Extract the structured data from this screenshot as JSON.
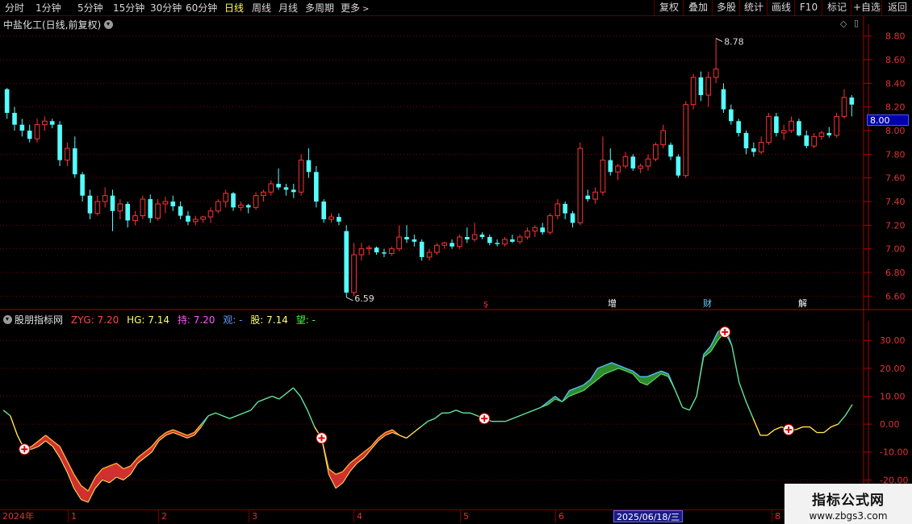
{
  "toolbar": {
    "left_items": [
      "分时",
      "1分钟",
      "5分钟",
      "15分钟",
      "30分钟",
      "60分钟",
      "日线",
      "周线",
      "月线",
      "多周期",
      "更多"
    ],
    "active": "日线",
    "right_items": [
      "复权",
      "叠加",
      "多股",
      "统计",
      "画线",
      "F10",
      "标记",
      "+自选",
      "返回"
    ]
  },
  "main_panel": {
    "title": "中盐化工(日线,前复权)",
    "max_label": "8.78",
    "min_label": "6.59",
    "current_price": "8.00",
    "y_ticks": [
      "8.80",
      "8.60",
      "8.40",
      "8.20",
      "8.00",
      "7.80",
      "7.60",
      "7.40",
      "7.20",
      "7.00",
      "6.80",
      "6.60"
    ],
    "events": [
      {
        "label": "ş",
        "color": "#ff3333"
      },
      {
        "label": "增",
        "color": "#ffffff"
      },
      {
        "label": "财",
        "color": "#66ccff"
      },
      {
        "label": "解",
        "color": "#ffffff"
      }
    ]
  },
  "indicator_panel": {
    "name": "股朋指标网",
    "values": [
      {
        "label": "ZYG: 7.20",
        "color": "#ff4444"
      },
      {
        "label": "HG: 7.14",
        "color": "#ffff66"
      },
      {
        "label": "持: 7.20",
        "color": "#ff55ff"
      },
      {
        "label": "观: -",
        "color": "#6699ff"
      },
      {
        "label": "股: 7.14",
        "color": "#ffff66"
      },
      {
        "label": "望: -",
        "color": "#44ff44"
      }
    ],
    "y_ticks": [
      "30.00",
      "20.00",
      "10.00",
      "0.00",
      "-10.00",
      "-20.00"
    ]
  },
  "date_axis": {
    "labels": [
      "2024年",
      "1",
      "2",
      "3",
      "4",
      "5",
      "6",
      "7",
      "8"
    ],
    "cursor": "2025/06/18/三"
  },
  "watermark": {
    "title": "指标公式网",
    "url": "www.zbgs3.com"
  },
  "colors": {
    "up": "#ff3333",
    "down": "#54ffff",
    "grid": "#800000",
    "band_green": "#2e8b2e",
    "band_red": "#d03030"
  },
  "chart_data": [
    {
      "type": "candlestick",
      "title": "中盐化工(日线,前复权)",
      "ylim": [
        6.5,
        8.9
      ],
      "ohlc": [
        [
          8.35,
          8.36,
          8.1,
          8.15
        ],
        [
          8.15,
          8.2,
          8.0,
          8.05
        ],
        [
          8.05,
          8.1,
          7.95,
          8.0
        ],
        [
          8.0,
          8.05,
          7.9,
          7.93
        ],
        [
          7.93,
          8.1,
          7.9,
          8.05
        ],
        [
          8.05,
          8.12,
          8.0,
          8.08
        ],
        [
          8.08,
          8.1,
          8.02,
          8.05
        ],
        [
          8.05,
          8.08,
          7.7,
          7.75
        ],
        [
          7.75,
          7.9,
          7.7,
          7.85
        ],
        [
          7.85,
          7.95,
          7.6,
          7.63
        ],
        [
          7.63,
          7.65,
          7.4,
          7.45
        ],
        [
          7.45,
          7.5,
          7.25,
          7.3
        ],
        [
          7.3,
          7.45,
          7.28,
          7.4
        ],
        [
          7.4,
          7.52,
          7.35,
          7.45
        ],
        [
          7.45,
          7.5,
          7.15,
          7.32
        ],
        [
          7.32,
          7.42,
          7.25,
          7.38
        ],
        [
          7.38,
          7.4,
          7.18,
          7.24
        ],
        [
          7.24,
          7.32,
          7.2,
          7.28
        ],
        [
          7.28,
          7.45,
          7.25,
          7.42
        ],
        [
          7.42,
          7.46,
          7.22,
          7.26
        ],
        [
          7.26,
          7.42,
          7.24,
          7.38
        ],
        [
          7.38,
          7.44,
          7.3,
          7.4
        ],
        [
          7.4,
          7.45,
          7.32,
          7.36
        ],
        [
          7.36,
          7.4,
          7.25,
          7.28
        ],
        [
          7.28,
          7.32,
          7.2,
          7.23
        ],
        [
          7.23,
          7.28,
          7.2,
          7.25
        ],
        [
          7.25,
          7.28,
          7.22,
          7.27
        ],
        [
          7.27,
          7.35,
          7.22,
          7.32
        ],
        [
          7.32,
          7.42,
          7.3,
          7.4
        ],
        [
          7.4,
          7.5,
          7.35,
          7.47
        ],
        [
          7.47,
          7.48,
          7.32,
          7.35
        ],
        [
          7.35,
          7.4,
          7.32,
          7.37
        ],
        [
          7.37,
          7.38,
          7.3,
          7.35
        ],
        [
          7.35,
          7.48,
          7.33,
          7.45
        ],
        [
          7.45,
          7.5,
          7.4,
          7.48
        ],
        [
          7.48,
          7.58,
          7.45,
          7.55
        ],
        [
          7.55,
          7.68,
          7.5,
          7.52
        ],
        [
          7.52,
          7.55,
          7.45,
          7.5
        ],
        [
          7.5,
          7.55,
          7.43,
          7.48
        ],
        [
          7.48,
          7.8,
          7.45,
          7.75
        ],
        [
          7.75,
          7.85,
          7.6,
          7.65
        ],
        [
          7.65,
          7.7,
          7.35,
          7.4
        ],
        [
          7.4,
          7.42,
          7.22,
          7.25
        ],
        [
          7.25,
          7.3,
          7.22,
          7.27
        ],
        [
          7.27,
          7.3,
          7.2,
          7.23
        ],
        [
          7.15,
          7.2,
          6.59,
          6.63
        ],
        [
          6.63,
          7.05,
          6.6,
          6.95
        ],
        [
          6.95,
          7.05,
          6.9,
          7.0
        ],
        [
          7.0,
          7.03,
          6.95,
          7.01
        ],
        [
          7.01,
          7.02,
          6.95,
          6.97
        ],
        [
          6.97,
          7.0,
          6.93,
          6.96
        ],
        [
          6.96,
          7.02,
          6.94,
          7.0
        ],
        [
          7.0,
          7.2,
          6.98,
          7.1
        ],
        [
          7.1,
          7.2,
          7.05,
          7.08
        ],
        [
          7.08,
          7.12,
          7.02,
          7.06
        ],
        [
          7.06,
          7.08,
          6.9,
          6.93
        ],
        [
          6.93,
          7.0,
          6.9,
          6.97
        ],
        [
          6.97,
          7.05,
          6.95,
          7.03
        ],
        [
          7.03,
          7.06,
          7.0,
          7.05
        ],
        [
          7.05,
          7.08,
          7.0,
          7.02
        ],
        [
          7.02,
          7.12,
          7.0,
          7.1
        ],
        [
          7.1,
          7.18,
          7.05,
          7.08
        ],
        [
          7.08,
          7.22,
          7.06,
          7.12
        ],
        [
          7.12,
          7.14,
          7.08,
          7.1
        ],
        [
          7.1,
          7.12,
          7.03,
          7.05
        ],
        [
          7.05,
          7.08,
          7.02,
          7.04
        ],
        [
          7.04,
          7.1,
          7.02,
          7.08
        ],
        [
          7.08,
          7.12,
          7.05,
          7.06
        ],
        [
          7.06,
          7.12,
          7.04,
          7.1
        ],
        [
          7.1,
          7.18,
          7.08,
          7.15
        ],
        [
          7.15,
          7.2,
          7.1,
          7.18
        ],
        [
          7.18,
          7.22,
          7.12,
          7.14
        ],
        [
          7.14,
          7.3,
          7.12,
          7.28
        ],
        [
          7.28,
          7.42,
          7.25,
          7.38
        ],
        [
          7.38,
          7.4,
          7.25,
          7.3
        ],
        [
          7.3,
          7.32,
          7.18,
          7.22
        ],
        [
          7.22,
          7.9,
          7.2,
          7.85
        ],
        [
          7.45,
          7.5,
          7.4,
          7.42
        ],
        [
          7.42,
          7.52,
          7.38,
          7.48
        ],
        [
          7.48,
          7.95,
          7.45,
          7.75
        ],
        [
          7.75,
          7.85,
          7.62,
          7.65
        ],
        [
          7.65,
          7.72,
          7.58,
          7.7
        ],
        [
          7.7,
          7.82,
          7.68,
          7.78
        ],
        [
          7.78,
          7.8,
          7.66,
          7.68
        ],
        [
          7.68,
          7.72,
          7.64,
          7.7
        ],
        [
          7.7,
          7.8,
          7.66,
          7.76
        ],
        [
          7.76,
          7.9,
          7.74,
          7.88
        ],
        [
          7.88,
          8.05,
          7.85,
          8.0
        ],
        [
          7.88,
          7.9,
          7.75,
          7.78
        ],
        [
          7.78,
          7.8,
          7.6,
          7.62
        ],
        [
          7.62,
          8.25,
          7.6,
          8.22
        ],
        [
          8.22,
          8.48,
          8.18,
          8.45
        ],
        [
          8.45,
          8.5,
          8.25,
          8.3
        ],
        [
          8.3,
          8.5,
          8.2,
          8.45
        ],
        [
          8.45,
          8.78,
          8.4,
          8.52
        ],
        [
          8.35,
          8.4,
          8.15,
          8.18
        ],
        [
          8.18,
          8.22,
          8.05,
          8.08
        ],
        [
          8.08,
          8.1,
          7.95,
          7.98
        ],
        [
          7.98,
          8.0,
          7.8,
          7.85
        ],
        [
          7.85,
          7.9,
          7.78,
          7.82
        ],
        [
          7.82,
          7.95,
          7.8,
          7.9
        ],
        [
          7.9,
          8.15,
          7.88,
          8.12
        ],
        [
          8.12,
          8.15,
          7.95,
          7.98
        ],
        [
          7.98,
          8.05,
          7.92,
          8.0
        ],
        [
          8.0,
          8.12,
          7.98,
          8.08
        ],
        [
          8.08,
          8.1,
          7.95,
          7.96
        ],
        [
          7.96,
          8.0,
          7.85,
          7.87
        ],
        [
          7.87,
          7.98,
          7.85,
          7.95
        ],
        [
          7.95,
          8.0,
          7.92,
          7.98
        ],
        [
          7.98,
          8.03,
          7.94,
          7.96
        ],
        [
          7.96,
          8.15,
          7.94,
          8.12
        ],
        [
          8.12,
          8.35,
          8.1,
          8.28
        ],
        [
          8.28,
          8.3,
          8.12,
          8.22
        ]
      ]
    },
    {
      "type": "area",
      "title": "股朋指标网",
      "ylim": [
        -30,
        37
      ],
      "series": [
        {
          "name": "HG",
          "values": [
            5,
            3,
            -4,
            -9,
            -9,
            -8,
            -6,
            -8,
            -12,
            -17,
            -23,
            -27,
            -28,
            -23,
            -20,
            -21,
            -19,
            -20,
            -18,
            -14,
            -12,
            -10,
            -6,
            -4,
            -3,
            -4,
            -5,
            -4,
            -1,
            3,
            4,
            3,
            2,
            3,
            4,
            5,
            8,
            9,
            10,
            9,
            11,
            13,
            10,
            5,
            -1,
            -5,
            -18,
            -23,
            -21,
            -17,
            -14,
            -12,
            -9,
            -6,
            -4,
            -3,
            -4,
            -5,
            -3,
            -1,
            1,
            2,
            4,
            4,
            5,
            4,
            4,
            3,
            2,
            1,
            1,
            1,
            2,
            3,
            4,
            5,
            6,
            7,
            9,
            8,
            10,
            11,
            12,
            14,
            16,
            18,
            19,
            20,
            19,
            18,
            15,
            14,
            16,
            18,
            17,
            12,
            6,
            5,
            10,
            24,
            26,
            30,
            33,
            28,
            15,
            8,
            2,
            -4,
            -4,
            -2,
            -1,
            -2,
            -2,
            -1,
            -1,
            -3,
            -3,
            -1,
            0,
            3,
            7
          ]
        },
        {
          "name": "ZYG",
          "values": [
            5,
            3,
            -4,
            -9,
            -8,
            -6,
            -4,
            -6,
            -8,
            -13,
            -18,
            -22,
            -24,
            -19,
            -16,
            -15,
            -14,
            -16,
            -15,
            -12,
            -10,
            -8,
            -5,
            -3,
            -2,
            -3,
            -4,
            -3,
            0,
            3,
            4,
            3,
            2,
            3,
            4,
            5,
            8,
            9,
            10,
            9,
            11,
            13,
            10,
            5,
            -1,
            -5,
            -16,
            -18,
            -17,
            -14,
            -12,
            -10,
            -8,
            -5,
            -3,
            -2,
            -4,
            -5,
            -3,
            -1,
            1,
            2,
            4,
            4,
            5,
            4,
            4,
            3,
            2,
            1,
            1,
            1,
            2,
            3,
            4,
            5,
            6,
            8,
            10,
            8,
            12,
            13,
            14,
            16,
            20,
            21,
            22,
            21,
            20,
            19,
            17,
            17,
            18,
            19,
            18,
            12,
            6,
            5,
            10,
            25,
            28,
            33,
            35,
            28,
            15,
            8,
            2,
            -4,
            -4,
            -2,
            -1,
            -2,
            -2,
            -1,
            -1,
            -3,
            -3,
            -1,
            0,
            3,
            7
          ]
        }
      ],
      "markers_at_index": [
        3,
        45,
        68,
        102,
        111
      ]
    }
  ]
}
